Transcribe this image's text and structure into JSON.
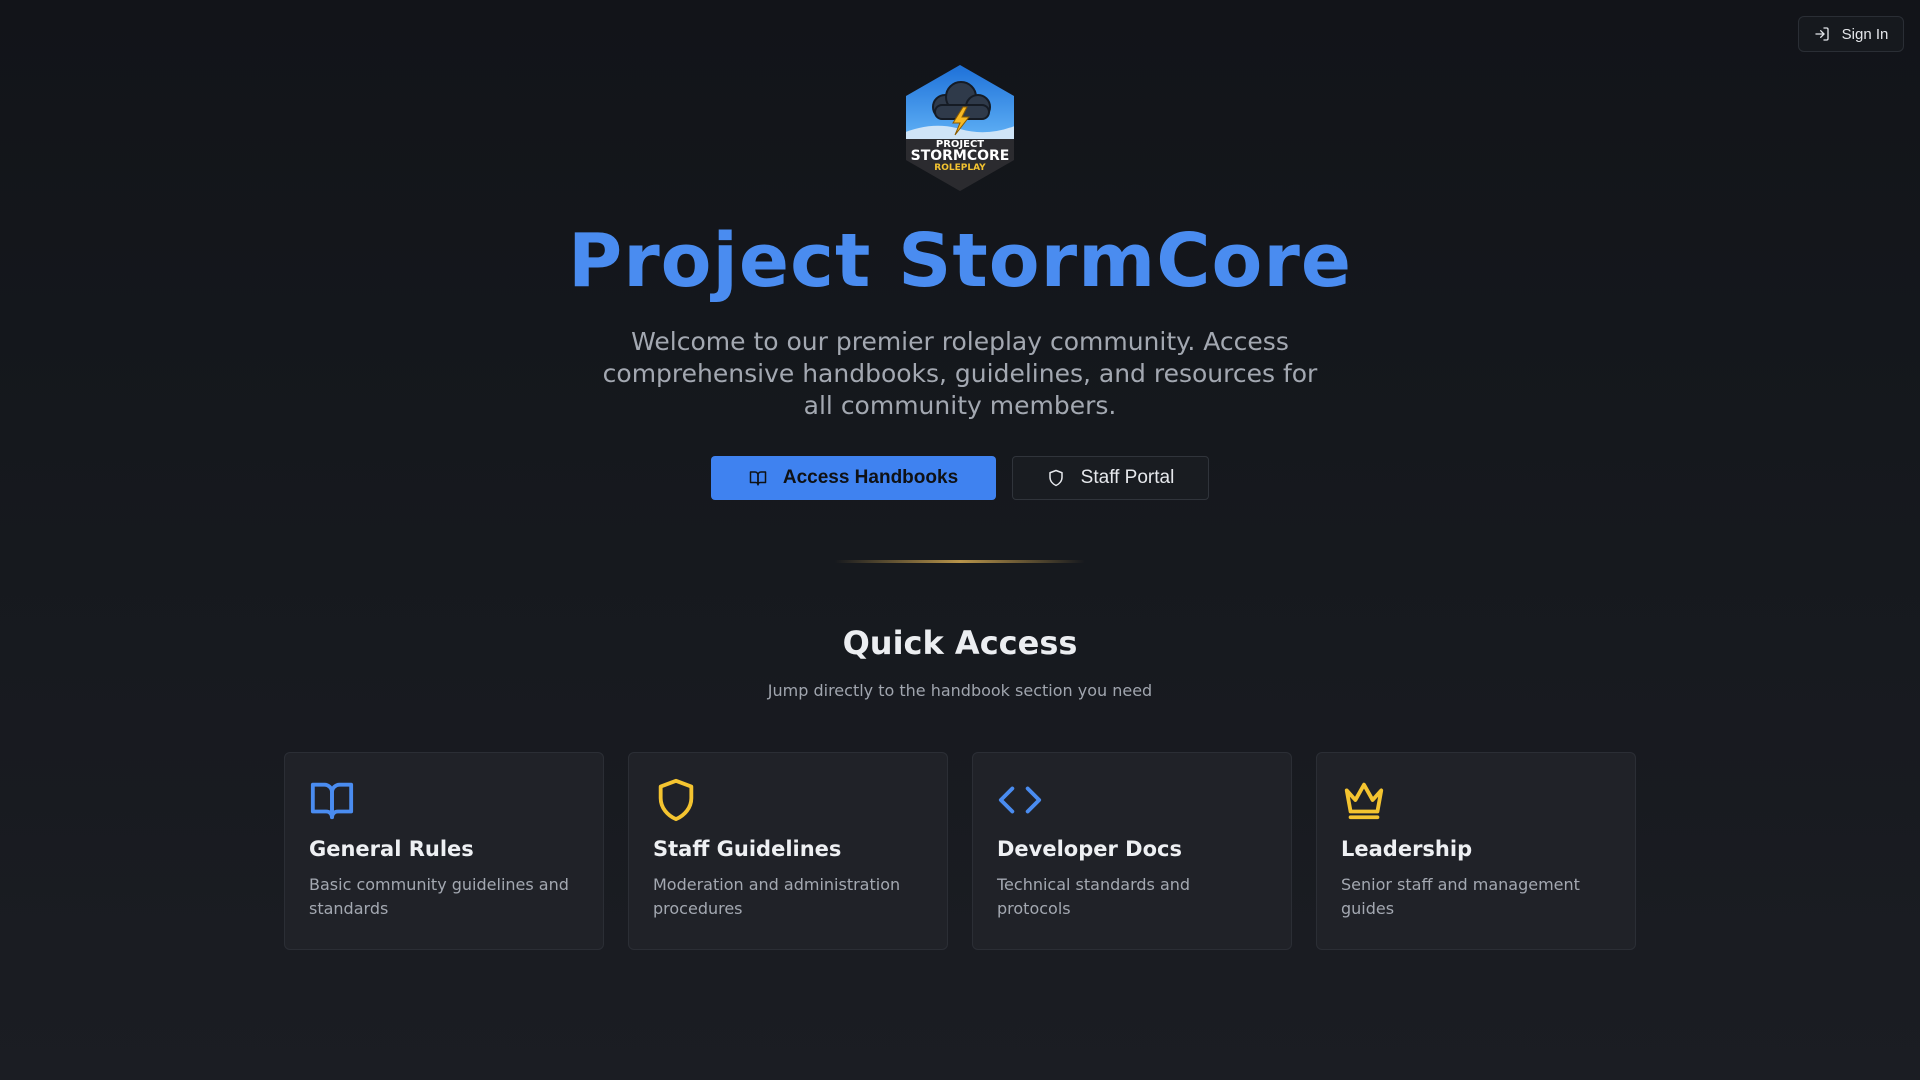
{
  "header": {
    "signin_label": "Sign In",
    "signin_icon": "log-in-icon"
  },
  "brand": {
    "logo_line1": "PROJECT",
    "logo_line2": "STORMCORE",
    "logo_line3": "ROLEPLAY",
    "title": "Project StormCore",
    "subtitle": "Welcome to our premier roleplay community. Access comprehensive handbooks, guidelines, and resources for all community members."
  },
  "actions": {
    "primary_label": "Access Handbooks",
    "primary_icon": "book-open-icon",
    "secondary_label": "Staff Portal",
    "secondary_icon": "shield-icon"
  },
  "quick_access": {
    "title": "Quick Access",
    "subtitle": "Jump directly to the handbook section you need",
    "cards": [
      {
        "title": "General Rules",
        "desc": "Basic community guidelines and standards",
        "icon": "book-open-icon",
        "color": "#4a8cf0"
      },
      {
        "title": "Staff Guidelines",
        "desc": "Moderation and administration procedures",
        "icon": "shield-icon",
        "color": "#f4c430"
      },
      {
        "title": "Developer Docs",
        "desc": "Technical standards and protocols",
        "icon": "code-icon",
        "color": "#4a8cf0"
      },
      {
        "title": "Leadership",
        "desc": "Senior staff and management guides",
        "icon": "crown-icon",
        "color": "#f4c430"
      }
    ]
  },
  "colors": {
    "accent": "#4a8cf0",
    "gold": "#f4c430",
    "background": "#15181d"
  }
}
